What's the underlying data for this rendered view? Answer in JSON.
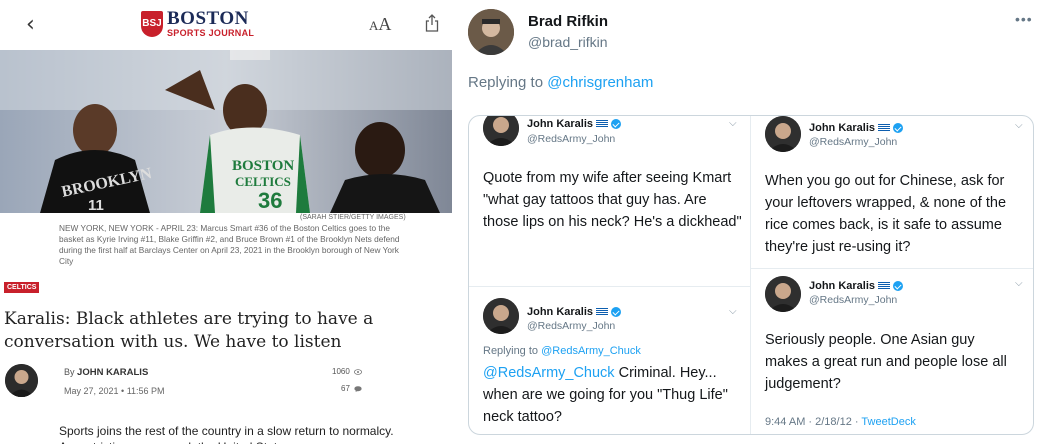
{
  "article": {
    "back_icon": "chevron-left-icon",
    "logo": {
      "badge": "BSJ",
      "line1": "BOSTON",
      "line2": "SPORTS JOURNAL"
    },
    "text_size": {
      "small": "A",
      "large": "A"
    },
    "photo_credit": "(SARAH STIER/GETTY IMAGES)",
    "photo_text": {
      "jersey_team": "BOSTON",
      "jersey_team2": "CELTICS",
      "jersey_number": "36",
      "other_jersey": "BROOKLYN",
      "other_number": "11"
    },
    "caption": "NEW YORK, NEW YORK - APRIL 23: Marcus Smart #36 of the Boston Celtics goes to the basket as Kyrie Irving #11, Blake Griffin #2, and Bruce Brown #1 of the Brooklyn Nets defend during the first half at Barclays Center on April 23, 2021 in the Brooklyn borough of New York City",
    "tag": "CELTICS",
    "headline": "Karalis: Black athletes are trying to have a conversation with us. We have to listen",
    "byline_prefix": "By",
    "author": "JOHN KARALIS",
    "date": "May 27, 2021 • 11:56 PM",
    "views": "1060",
    "comments": "67",
    "body": "Sports joins the rest of the country in a slow return to normalcy. As restrictions are eased, the United States"
  },
  "tweet": {
    "name": "Brad Rifkin",
    "handle": "@brad_rifkin",
    "more": "•••",
    "replying_prefix": "Replying to",
    "replying_to": "@chrisgrenham",
    "quoted": [
      {
        "name": "John Karalis",
        "handle": "@RedsArmy_John",
        "text": "Quote from my wife after seeing Kmart \"what gay tattoos that guy has. Are those lips on his neck?  He's a dickhead\""
      },
      {
        "name": "John Karalis",
        "handle": "@RedsArmy_John",
        "reply_prefix": "Replying to",
        "reply_to": "@RedsArmy_Chuck",
        "mention": "@RedsArmy_Chuck",
        "text": " Criminal.  Hey... when are we going for you \"Thug Life\" neck tattoo?"
      },
      {
        "name": "John Karalis",
        "handle": "@RedsArmy_John",
        "text": "When you go out for Chinese, ask for your leftovers wrapped, & none of the rice comes back, is it safe to assume they're just re-using it?"
      },
      {
        "name": "John Karalis",
        "handle": "@RedsArmy_John",
        "text": "Seriously people.  One Asian guy makes a great run and people lose all judgement?",
        "time": "9:44 AM · 2/18/12 ·",
        "source": "TweetDeck"
      }
    ]
  }
}
